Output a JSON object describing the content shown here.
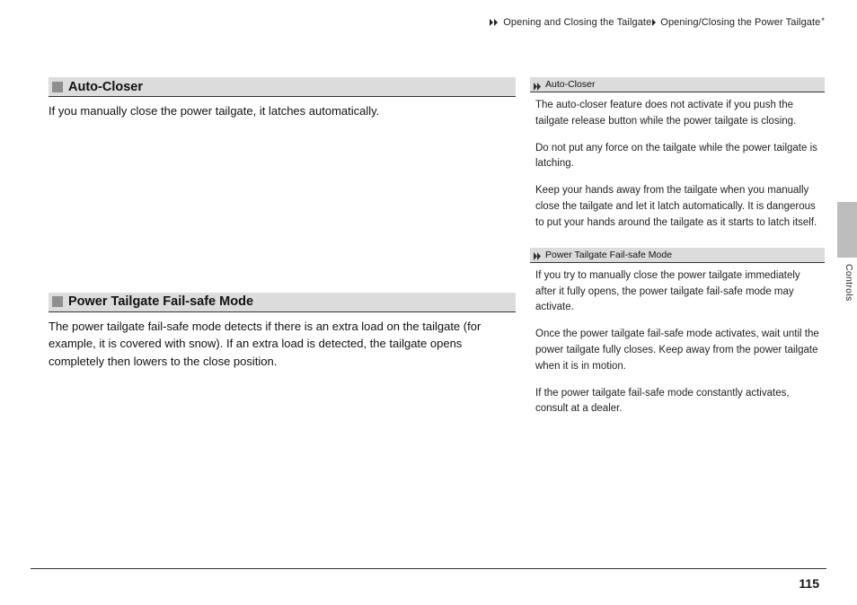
{
  "breadcrumb": {
    "part1": "Opening and Closing the Tailgate",
    "part2": "Opening/Closing the Power Tailgate",
    "footnote_marker": "*"
  },
  "main_sections": [
    {
      "title": "Auto-Closer",
      "body": "If you manually close the power tailgate, it latches automatically."
    },
    {
      "title": "Power Tailgate Fail-safe Mode",
      "body": "The power tailgate fail-safe mode detects if there is an extra load on the tailgate (for example, it is covered with snow). If an extra load is detected, the tailgate opens completely then lowers to the close position."
    }
  ],
  "tips": [
    {
      "title": "Auto-Closer",
      "paragraphs": [
        "The auto-closer feature does not activate if you push the tailgate release button while the power tailgate is closing.",
        "Do not put any force on the tailgate while the power tailgate is latching.",
        "Keep your hands away from the tailgate when you manually close the tailgate and let it latch automatically. It is dangerous to put your hands around the tailgate as it starts to latch itself."
      ]
    },
    {
      "title": "Power Tailgate Fail-safe Mode",
      "paragraphs": [
        "If you try to manually close the power tailgate immediately after it fully opens, the power tailgate fail-safe mode may activate.",
        "Once the power tailgate fail-safe mode activates, wait until the power tailgate fully closes. Keep away from the power tailgate when it is in motion.",
        "If the power tailgate fail-safe mode constantly activates, consult at a dealer."
      ]
    }
  ],
  "side_tab_label": "Controls",
  "page_number": "115"
}
